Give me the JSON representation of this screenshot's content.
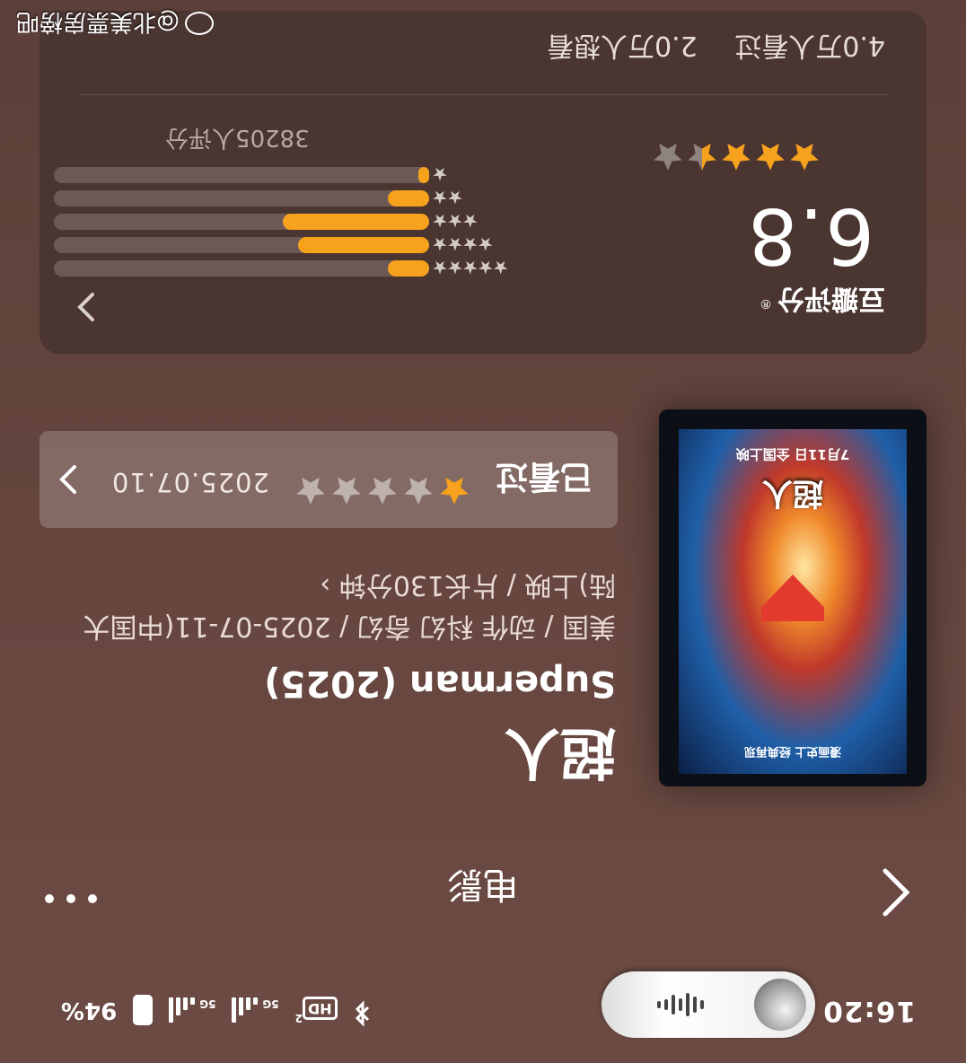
{
  "status": {
    "time": "16:20",
    "battery": "94%",
    "hd_label": "HD",
    "hd_sub": "2",
    "net1": "5G",
    "net2": "5G"
  },
  "nav": {
    "title": "电影"
  },
  "movie": {
    "title_cn": "超人",
    "title_en": "Superman (2025)",
    "meta": "美国 / 动作 科幻 奇幻 / 2025-07-11(中国大陆)上映 / 片长130分钟",
    "meta_chev": "›",
    "poster_title": "超人",
    "poster_date": "7月11日 全国上映",
    "poster_tag": "漫画史上 经典再现"
  },
  "watched": {
    "label": "已看过",
    "date": "2025.07.10",
    "user_stars_out_of_5": 1
  },
  "rating": {
    "source": "豆瓣评分",
    "mark": "®",
    "score": "6.8",
    "stars_out_of_5": 3.5,
    "count_text": "38205人评分",
    "distribution_fraction": [
      0.11,
      0.35,
      0.39,
      0.11,
      0.02
    ],
    "distribution_labels": [
      "★★★★★",
      "★★★★",
      "★★★",
      "★★",
      "★"
    ],
    "seen_text": "4.0万人看过",
    "want_text": "2.0万人想看",
    "accent_color": "#f7a21c"
  },
  "watermark": "@北美票房榜吧"
}
